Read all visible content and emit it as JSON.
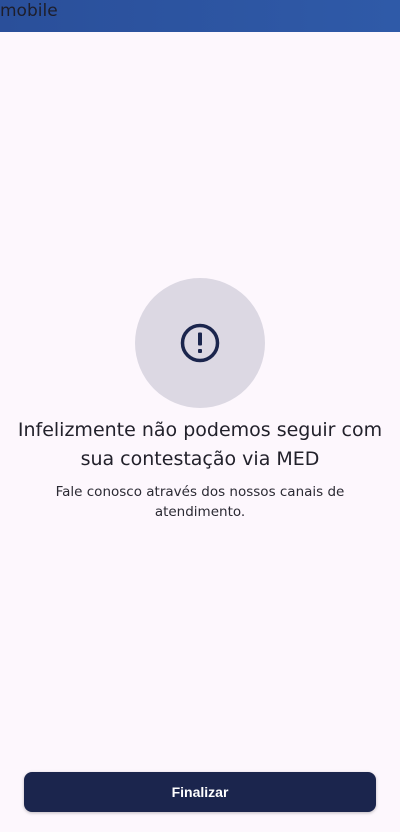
{
  "app": {
    "title": "mobile"
  },
  "alert": {
    "icon": "exclamation-circle-icon",
    "title": "Infelizmente não podemos seguir com sua contestação via MED",
    "subtitle": "Fale conosco através dos nossos canais de atendimento."
  },
  "actions": {
    "finish_label": "Finalizar"
  },
  "colors": {
    "top_bar": "#2c53a1",
    "background": "#fdf7fd",
    "icon_circle": "#dcd8e3",
    "icon": "#1b254d",
    "button": "#1b254d",
    "button_text": "#ffffff"
  }
}
